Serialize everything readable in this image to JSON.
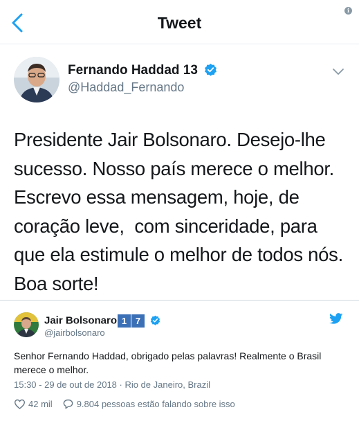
{
  "header": {
    "title": "Tweet",
    "back_icon": "chevron-left-icon",
    "info_icon": "info-icon",
    "info_glyph": "i"
  },
  "tweet": {
    "author_name": "Fernando Haddad 13",
    "author_handle": "@Haddad_Fernando",
    "verified": true,
    "text_lines": [
      "Presidente Jair Bolsonaro. Desejo-lhe",
      "sucesso. Nosso país merece o melhor.",
      "Escrevo essa mensagem, hoje, de",
      "coração leve,  com sinceridade, para",
      "que ela estimule o melhor de todos nós.",
      "Boa sorte!"
    ]
  },
  "quoted": {
    "author_name": "Jair Bolsonaro",
    "badges": [
      "1",
      "7"
    ],
    "verified": true,
    "author_handle": "@jairbolsonaro",
    "text": "Senhor Fernando Haddad, obrigado pelas palavras! Realmente o Brasil merece o melhor.",
    "meta": "15:30 - 29 de out de 2018 · Rio de Janeiro, Brazil",
    "likes": "42 mil",
    "talking": "9.804 pessoas estão falando sobre isso"
  },
  "colors": {
    "accent": "#1da1f2",
    "text": "#14171a",
    "muted": "#657786",
    "badge": "#3b6fb6"
  }
}
